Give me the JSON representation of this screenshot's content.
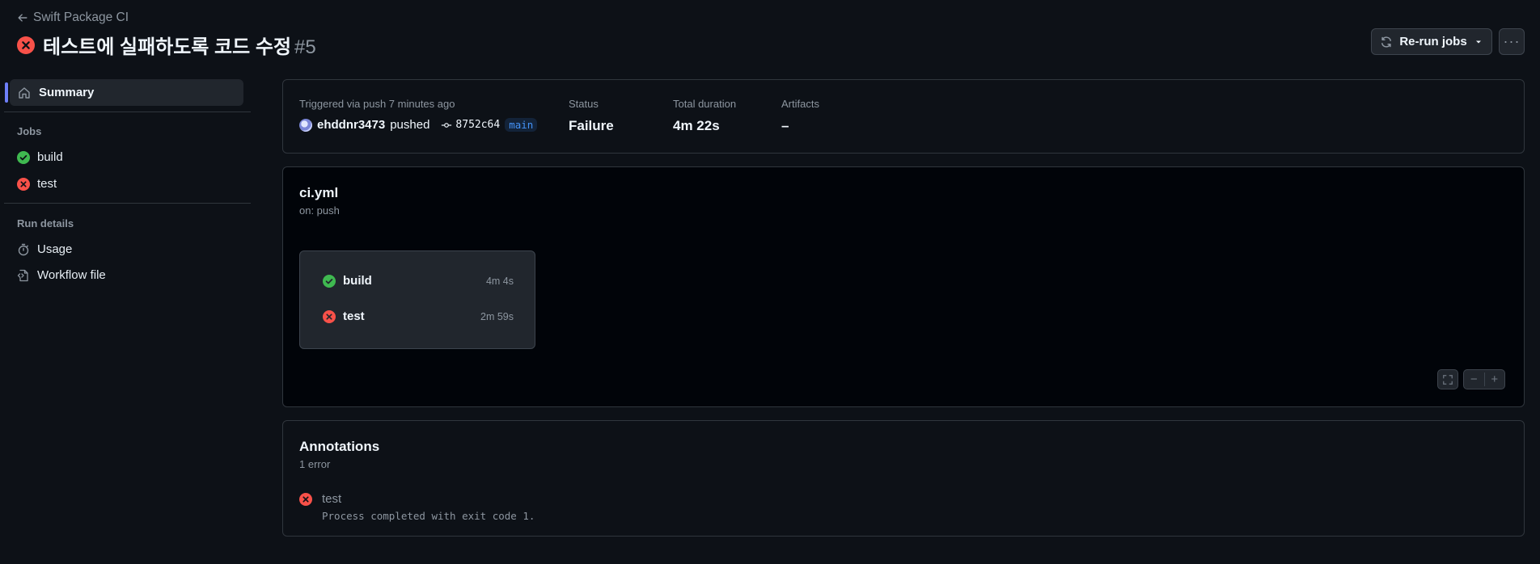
{
  "header": {
    "back_label": "Swift Package CI",
    "title": "테스트에 실패하도록 코드 수정",
    "run_number": "#5",
    "rerun_label": "Re-run jobs",
    "more_label": "···"
  },
  "sidebar": {
    "summary_label": "Summary",
    "jobs_heading": "Jobs",
    "jobs": [
      {
        "label": "build",
        "status": "success"
      },
      {
        "label": "test",
        "status": "failure"
      }
    ],
    "run_details_heading": "Run details",
    "details": [
      {
        "label": "Usage",
        "icon": "stopwatch-icon"
      },
      {
        "label": "Workflow file",
        "icon": "file-code-icon"
      }
    ]
  },
  "summary": {
    "trigger_label": "Triggered via push 7 minutes ago",
    "actor": "ehddnr3473",
    "action": "pushed",
    "commit_sha": "8752c64",
    "branch": "main",
    "status_label": "Status",
    "status_value": "Failure",
    "duration_label": "Total duration",
    "duration_value": "4m 22s",
    "artifacts_label": "Artifacts",
    "artifacts_value": "–"
  },
  "workflow": {
    "file": "ci.yml",
    "trigger": "on: push",
    "jobs": [
      {
        "name": "build",
        "duration": "4m 4s",
        "status": "success"
      },
      {
        "name": "test",
        "duration": "2m 59s",
        "status": "failure"
      }
    ],
    "zoom_out": "−",
    "zoom_in": "+"
  },
  "annotations": {
    "title": "Annotations",
    "count": "1 error",
    "items": [
      {
        "job": "test",
        "message": "Process completed with exit code 1."
      }
    ]
  },
  "colors": {
    "background": "#0d1117",
    "success": "#3fb950",
    "failure": "#f85149",
    "accent": "#6e7ff8",
    "branch": "#4493f8"
  }
}
